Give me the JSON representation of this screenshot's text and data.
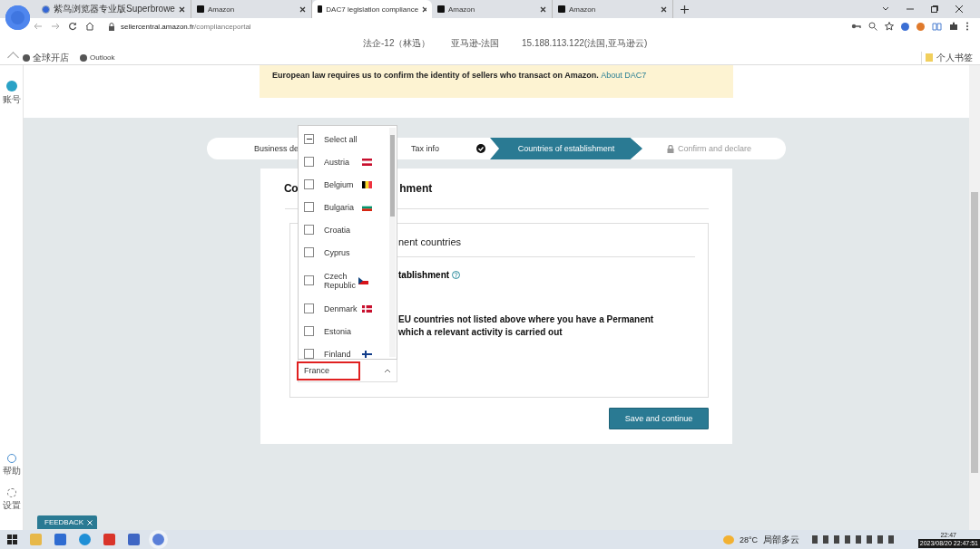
{
  "browser": {
    "tabs": [
      {
        "title": "紫鸟浏览器专业版Superbrowe",
        "selected": false,
        "kind": "browser"
      },
      {
        "title": "Amazon",
        "selected": false,
        "kind": "amazon"
      },
      {
        "title": "DAC7 legislation compliance",
        "selected": true,
        "kind": "amazon"
      },
      {
        "title": "Amazon",
        "selected": false,
        "kind": "amazon"
      },
      {
        "title": "Amazon",
        "selected": false,
        "kind": "amazon"
      }
    ],
    "url_host": "sellercentral.amazon.fr",
    "url_path": "/complianceportal",
    "account_bar": [
      "法企-12（林迅）",
      "亚马逊-法国",
      "15.188.113.122(法国,亚马逊云)"
    ],
    "bookmarks": [
      "全球开店",
      "Outlook"
    ],
    "bookmarks_folder": "个人书签"
  },
  "sidebar": {
    "top": [
      {
        "label": "账号",
        "kind": "account"
      }
    ],
    "bottom": [
      {
        "label": "帮助",
        "kind": "help"
      },
      {
        "label": "设置",
        "kind": "settings"
      }
    ]
  },
  "banner": {
    "text": "European law requires us to confirm the identity of sellers who transact on Amazon.",
    "link": "About DAC7"
  },
  "stepper": [
    {
      "label": "Business de",
      "kind": "plain",
      "selected": false
    },
    {
      "label": "Tax info",
      "kind": "done",
      "selected": false
    },
    {
      "label": "Countries of establishment",
      "kind": "plain",
      "selected": true
    },
    {
      "label": "Confirm and declare",
      "kind": "locked",
      "selected": false
    }
  ],
  "card": {
    "title_start": "Co",
    "title_end": "hment",
    "section_title": "nent countries",
    "field_label": "tablishment",
    "paragraph": [
      "EU countries not listed above where you have a Permanent",
      "which a relevant activity is carried out"
    ],
    "button": "Save and continue"
  },
  "dropdown": {
    "select_all": {
      "label": "Select all",
      "indeterminate": true
    },
    "options": [
      {
        "label": "Austria",
        "checked": false,
        "kind": "austria"
      },
      {
        "label": "Belgium",
        "checked": false,
        "kind": "belgium"
      },
      {
        "label": "Bulgaria",
        "checked": false,
        "kind": "bulgaria"
      },
      {
        "label": "Croatia",
        "checked": false
      },
      {
        "label": "Cyprus",
        "checked": false
      },
      {
        "label": "Czech Republic",
        "checked": false,
        "kind": "czech"
      },
      {
        "label": "Denmark",
        "checked": false,
        "kind": "denmark"
      },
      {
        "label": "Estonia",
        "checked": false
      },
      {
        "label": "Finland",
        "checked": false,
        "kind": "finland"
      }
    ],
    "value": "France",
    "highlighted": true
  },
  "feedback": "FEEDBACK",
  "taskbar": {
    "weather": "28°C",
    "weather_text": "局部多云",
    "time": "22:47",
    "timestamp": "2023/08/20 22:47:51"
  }
}
